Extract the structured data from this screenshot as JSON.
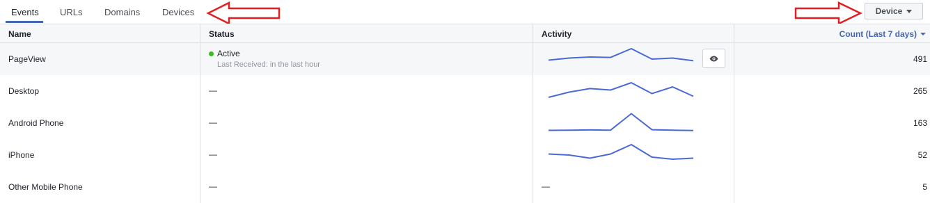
{
  "tabs": [
    {
      "label": "Events",
      "active": true
    },
    {
      "label": "URLs",
      "active": false
    },
    {
      "label": "Domains",
      "active": false
    },
    {
      "label": "Devices",
      "active": false
    }
  ],
  "device_button": {
    "label": "Device"
  },
  "table": {
    "headers": {
      "name": "Name",
      "status": "Status",
      "activity": "Activity",
      "count": "Count (Last 7 days)"
    },
    "rows": [
      {
        "name": "PageView",
        "status": "Active",
        "status_sub": "Last Received: in the last hour",
        "count": "491",
        "sparkline": [
          0.45,
          0.55,
          0.6,
          0.58,
          1.0,
          0.5,
          0.55,
          0.42
        ]
      },
      {
        "name": "Desktop",
        "status": "—",
        "count": "265",
        "sparkline": [
          0.2,
          0.45,
          0.62,
          0.55,
          0.9,
          0.38,
          0.7,
          0.25
        ]
      },
      {
        "name": "Android Phone",
        "status": "—",
        "count": "163",
        "sparkline": [
          0.15,
          0.16,
          0.17,
          0.16,
          0.95,
          0.18,
          0.16,
          0.14
        ]
      },
      {
        "name": "iPhone",
        "status": "—",
        "count": "52",
        "sparkline": [
          0.55,
          0.5,
          0.35,
          0.55,
          1.0,
          0.4,
          0.3,
          0.35
        ]
      },
      {
        "name": "Other Mobile Phone",
        "status": "—",
        "activity": "—",
        "count": "5"
      }
    ]
  },
  "colors": {
    "accent": "#4267b2",
    "sparkline": "#4a69d6",
    "active_dot": "#42b72a",
    "annotation_arrow": "#e02020"
  }
}
